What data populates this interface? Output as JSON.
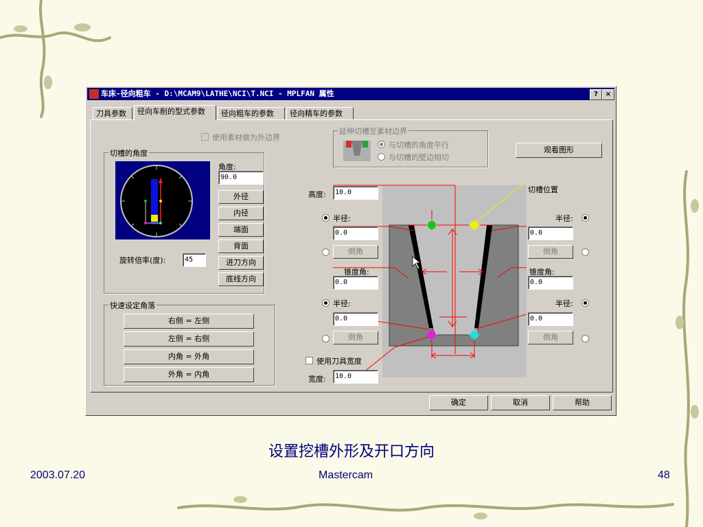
{
  "colors": {
    "title_bg": "#000080",
    "face": "#d4d0c8",
    "caption": "#000080",
    "diagram_bg": "#c0c0c0",
    "groove": "#808080",
    "red": "#ff0000"
  },
  "window": {
    "title": "车床-径向粗车 - D:\\MCAM9\\LATHE\\NCI\\T.NCI - MPLFAN 属性",
    "help_btn": "?",
    "close_btn": "×"
  },
  "tabs": [
    {
      "label": "刀具参数"
    },
    {
      "label": "径向车削的型式参数"
    },
    {
      "label": "径向粗车的参数"
    },
    {
      "label": "径向精车的参数"
    }
  ],
  "stock_boundary": {
    "label": "使用素材做为外边界",
    "checked": false
  },
  "extend": {
    "title": "延伸切槽至素材边界",
    "opt1": "与切槽的角度平行",
    "opt2": "与切槽的壁边相切"
  },
  "view_btn": "观看图形",
  "angle_group": {
    "title": "切槽的角度",
    "angle_label": "角度:",
    "angle_value": "90.0",
    "buttons": [
      "外径",
      "内径",
      "端面",
      "背面",
      "进刀方向",
      "底线方向"
    ],
    "rotate_label": "旋转倍率(度):",
    "rotate_value": "45"
  },
  "quick": {
    "title": "快速设定角落",
    "buttons": [
      "右侧 = 左侧",
      "左侧 = 右侧",
      "内角 = 外角",
      "外角 = 内角"
    ]
  },
  "diagram": {
    "position_label": "切槽位置"
  },
  "left_params": {
    "height_label": "高度:",
    "height_value": "10.0",
    "radius_label": "半径:",
    "radius1_value": "0.0",
    "chamfer_label": "倒角",
    "taper_label": "锥度角:",
    "taper_value": "0.0",
    "radius2_value": "0.0",
    "tool_width_label": "使用刀具宽度",
    "width_label": "宽度:",
    "width_value": "10.0"
  },
  "right_params": {
    "radius_label": "半径:",
    "radius1_value": "0.0",
    "chamfer_label": "倒角",
    "taper_label": "锥度角:",
    "taper_value": "0.0",
    "radius2_value": "0.0"
  },
  "footer_buttons": {
    "ok": "确定",
    "cancel": "取消",
    "help": "帮助"
  },
  "slide": {
    "caption": "设置挖槽外形及开口方向",
    "date": "2003.07.20",
    "center": "Mastercam",
    "page": "48"
  }
}
